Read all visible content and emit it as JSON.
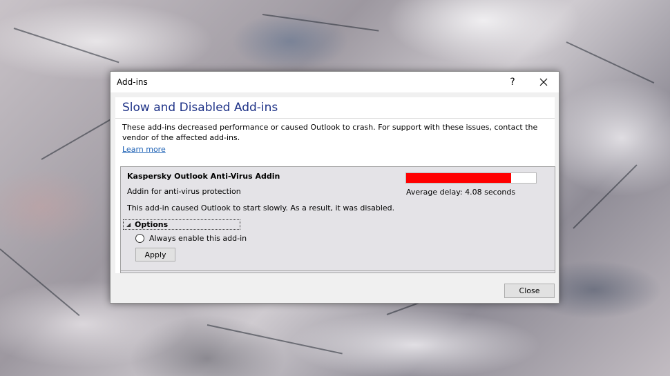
{
  "window": {
    "title": "Add-ins",
    "help_label": "?",
    "close_icon": "close-icon"
  },
  "main": {
    "heading": "Slow and Disabled Add-ins",
    "description": "These add-ins decreased performance or caused Outlook to crash. For support with these issues, contact the vendor of the affected add-ins.",
    "learn_more": "Learn more"
  },
  "addin": {
    "name": "Kaspersky Outlook Anti-Virus Addin",
    "description": "Addin for anti-virus protection",
    "status": "This add-in caused Outlook to start slowly. As a result, it was disabled.",
    "delay_label": "Average delay: 4.08 seconds",
    "delay_fraction": 0.81,
    "delay_color": "#ff0000"
  },
  "options": {
    "label": "Options",
    "radio_label": "Always enable this add-in",
    "radio_checked": false,
    "apply_label": "Apply"
  },
  "footer": {
    "close_label": "Close"
  }
}
